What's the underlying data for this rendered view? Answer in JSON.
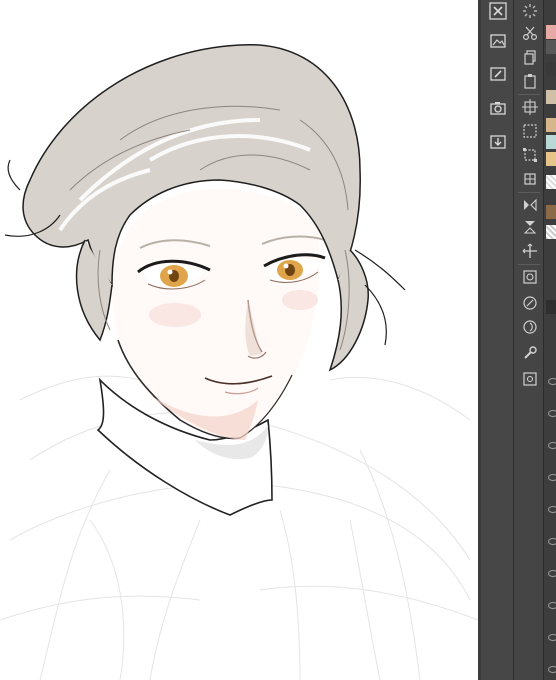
{
  "canvas": {
    "background": "#ffffff",
    "artwork": "portrait-illustration"
  },
  "toolbar": {
    "items": [
      {
        "icon": "close-canvas-icon"
      },
      {
        "icon": "image-import-icon"
      },
      {
        "icon": "edit-icon"
      },
      {
        "icon": "camera-icon"
      },
      {
        "icon": "download-icon"
      }
    ]
  },
  "toolbar2": {
    "items": [
      {
        "icon": "loading-icon"
      },
      {
        "icon": "cut-icon"
      },
      {
        "icon": "copy-icon"
      },
      {
        "icon": "paste-icon"
      },
      {
        "icon": "selection-move-icon"
      },
      {
        "icon": "selection-rect-icon"
      },
      {
        "icon": "crop-icon"
      },
      {
        "icon": "transform-icon"
      },
      {
        "icon": "flip-horizontal-icon"
      },
      {
        "icon": "flip-vertical-icon"
      },
      {
        "icon": "move-icon"
      },
      {
        "icon": "fill-selection-icon"
      },
      {
        "icon": "eyedropper-icon"
      },
      {
        "icon": "lasso-icon"
      },
      {
        "icon": "wrench-icon"
      },
      {
        "icon": "settings-icon"
      }
    ]
  },
  "palette": {
    "swatches": [
      "#e7a9a6",
      "#cfc0a6",
      "#b9d9d6",
      "#e6c48a",
      "#d8b68b",
      "#8a6a48"
    ]
  }
}
